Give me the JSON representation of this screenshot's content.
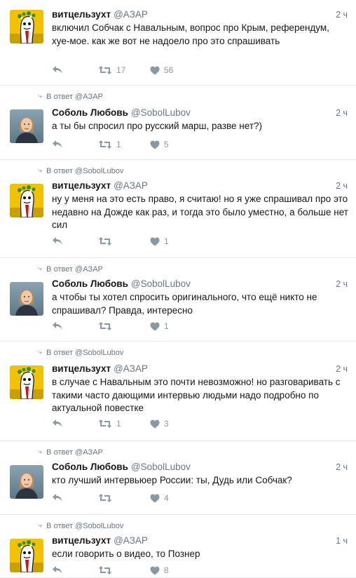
{
  "tweets": [
    {
      "reply_to": "",
      "name": "витцельзухт",
      "handle": "@AЗAP",
      "time": "2 ч",
      "text": "включил Собчак с Навальным, вопрос про Крым, референдум, хуе-мое. как же вот не надоело про это спрашивать",
      "retweets": "17",
      "likes": "56",
      "avatar": "cartoon"
    },
    {
      "reply_to": "В ответ @AЗAP",
      "name": "Соболь Любовь",
      "handle": "@SobolLubov",
      "time": "2 ч",
      "text": "а ты бы спросил про русский марш, разве нет?)",
      "retweets": "1",
      "likes": "5",
      "avatar": "photo"
    },
    {
      "reply_to": "В ответ @SobolLubov",
      "name": "витцельзухт",
      "handle": "@AЗAP",
      "time": "2 ч",
      "text": "ну у меня на это есть право, я считаю! но я уже спрашивал про это недавно на Дожде как раз, и тогда это было уместно, а больше нет сил",
      "retweets": "",
      "likes": "1",
      "avatar": "cartoon"
    },
    {
      "reply_to": "В ответ @AЗAP",
      "name": "Соболь Любовь",
      "handle": "@SobolLubov",
      "time": "2 ч",
      "text": "а чтобы ты хотел спросить оригинального, что ещё никто не спрашивал? Правда, интересно",
      "retweets": "",
      "likes": "1",
      "avatar": "photo"
    },
    {
      "reply_to": "В ответ @SobolLubov",
      "name": "витцельзухт",
      "handle": "@AЗAP",
      "time": "2 ч",
      "text": "в случае с Навальным это почти невозможно! но разговаривать с такими часто дающими интервью людьми надо подробно по актуальной повестке",
      "retweets": "1",
      "likes": "3",
      "avatar": "cartoon"
    },
    {
      "reply_to": "В ответ @AЗAP",
      "name": "Соболь Любовь",
      "handle": "@SobolLubov",
      "time": "2 ч",
      "text": "кто лучший интервьюер России: ты, Дудь или Собчак?",
      "retweets": "",
      "likes": "4",
      "avatar": "photo"
    },
    {
      "reply_to": "В ответ @SobolLubov",
      "name": "витцельзухт",
      "handle": "@AЗAP",
      "time": "1 ч",
      "text": "если говорить о видео, то Познер",
      "retweets": "",
      "likes": "8",
      "avatar": "cartoon"
    }
  ],
  "colors": {
    "icon": "#8899a6",
    "secondary_text": "#657786",
    "cartoon_bg": "#f2c200",
    "photo_bg": "#6f8a9a"
  }
}
